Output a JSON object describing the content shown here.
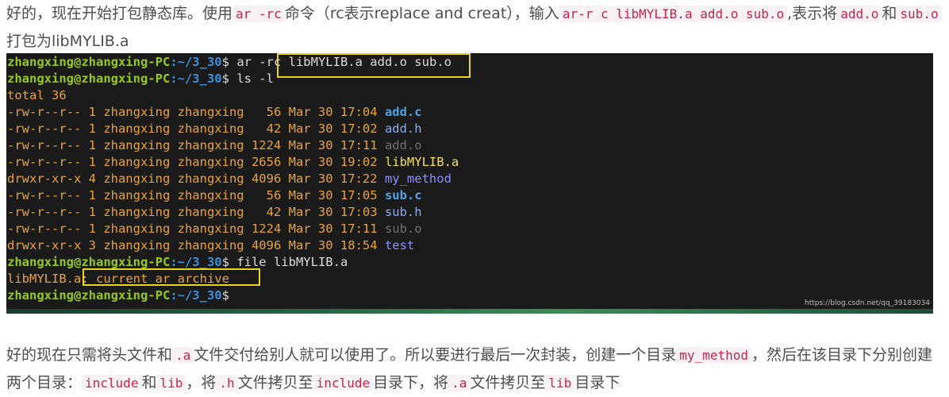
{
  "intro": {
    "t1": "好的，现在开始打包静态库。使用",
    "c1": "ar -rc",
    "t2": "命令（rc表示replace and creat），输入",
    "c2": "ar-r c libMYLIB.a add.o sub.o",
    "t3": ",表示将",
    "c3": "add.o",
    "t4": "和",
    "c4": "sub.o",
    "t5": "打包为libMYLIB.a"
  },
  "terminal": {
    "prompt_user": "zhangxing@zhangxing-PC",
    "prompt_path": ":~/3_30",
    "prompt_sign": "$",
    "cmd_ar_pre": " ar -rc",
    "cmd_ar_args": " libMYLIB.a add.o sub.o",
    "cmd_ls": " ls -l",
    "total": "total 36",
    "entries": [
      {
        "meta": "-rw-r--r-- 1 zhangxing zhangxing   56 Mar 30 17:04",
        "name": "add.c"
      },
      {
        "meta": "-rw-r--r-- 1 zhangxing zhangxing   42 Mar 30 17:02",
        "name": "add.h"
      },
      {
        "meta": "-rw-r--r-- 1 zhangxing zhangxing 1224 Mar 30 17:11",
        "name": "add.o"
      },
      {
        "meta": "-rw-r--r-- 1 zhangxing zhangxing 2656 Mar 30 19:02",
        "name": "libMYLIB.a"
      },
      {
        "meta": "drwxr-xr-x 4 zhangxing zhangxing 4096 Mar 30 17:22",
        "name": "my_method"
      },
      {
        "meta": "-rw-r--r-- 1 zhangxing zhangxing   56 Mar 30 17:05",
        "name": "sub.c"
      },
      {
        "meta": "-rw-r--r-- 1 zhangxing zhangxing   42 Mar 30 17:03",
        "name": "sub.h"
      },
      {
        "meta": "-rw-r--r-- 1 zhangxing zhangxing 1224 Mar 30 17:11",
        "name": "sub.o"
      },
      {
        "meta": "drwxr-xr-x 3 zhangxing zhangxing 4096 Mar 30 18:54",
        "name": "test"
      }
    ],
    "cmd_file": " file libMYLIB.a",
    "file_out_name": "libMYLIB.a:",
    "file_out_desc": " current ar archive",
    "highlight_color": "#e6d620"
  },
  "watermark": "https://blog.csdn.net/qq_39183034",
  "outro": {
    "t1": "好的现在只需将头文件和",
    "c1": ".a",
    "t2": "文件交付给别人就可以使用了。所以要进行最后一次封装，创建一个目录",
    "c2": "my_method",
    "t3": "，然后在该目录下分别创建两个目录：",
    "c3": "include",
    "t4": "和",
    "c4": "lib",
    "t5": "，将",
    "c5": ".h",
    "t6": "文件拷贝至",
    "c6": "include",
    "t7": "目录下，将",
    "c7": ".a",
    "t8": "文件拷贝至",
    "c8": "lib",
    "t9": "目录下"
  }
}
